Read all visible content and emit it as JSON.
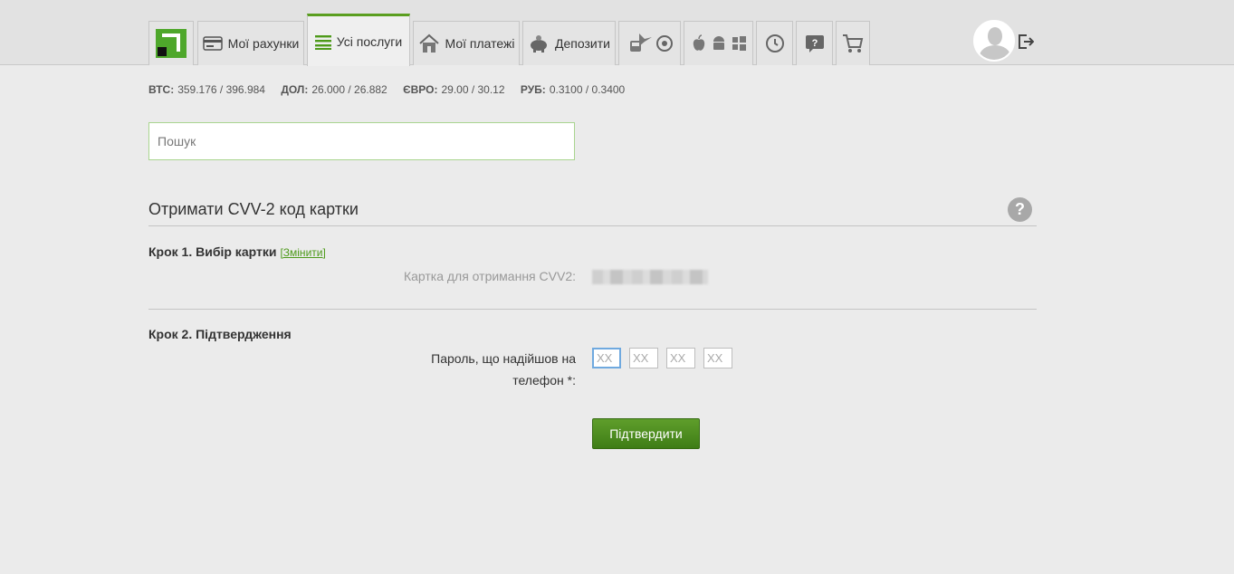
{
  "nav": {
    "tabs": [
      {
        "label": "Мої рахунки",
        "icon": "card-icon"
      },
      {
        "label": "Усі послуги",
        "icon": "list-icon",
        "active": true
      },
      {
        "label": "Мої платежі",
        "icon": "house-icon"
      },
      {
        "label": "Депозити",
        "icon": "piggy-bank-icon"
      }
    ]
  },
  "rates": [
    {
      "name": "ВТС:",
      "value": "359.176 / 396.984"
    },
    {
      "name": "ДОЛ:",
      "value": "26.000 / 26.882"
    },
    {
      "name": "ЄВРО:",
      "value": "29.00 / 30.12"
    },
    {
      "name": "РУБ:",
      "value": "0.3100 / 0.3400"
    }
  ],
  "search": {
    "placeholder": "Пошук"
  },
  "page": {
    "title": "Отримати CVV-2 код картки"
  },
  "step1": {
    "title": "Крок 1. Вибір картки",
    "change_link": "[Змінити]",
    "card_label": "Картка для отримання CVV2:"
  },
  "step2": {
    "title": "Крок 2. Підтвердження",
    "password_label_line1": "Пароль, що надійшов на",
    "password_label_line2": "телефон *:",
    "otp_placeholder": "XX",
    "confirm_label": "Підтвердити"
  },
  "colors": {
    "accent": "#5a9e1f",
    "button": "#4e8d21"
  }
}
